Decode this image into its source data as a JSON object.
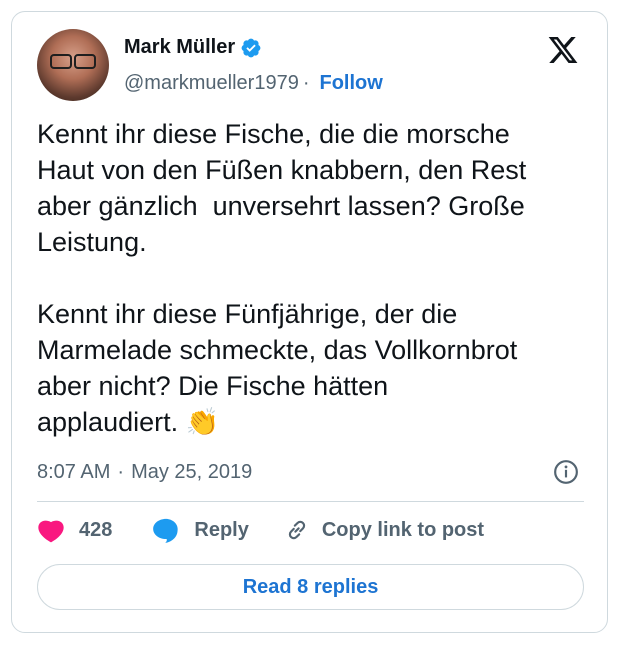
{
  "author": {
    "name": "Mark Müller",
    "handle": "@markmueller1979",
    "follow_label": "Follow",
    "separator": "·"
  },
  "tweet": {
    "text": "Kennt ihr diese Fische, die die morsche\nHaut von den Füßen knabbern, den Rest\naber gänzlich  unversehrt lassen? Große\nLeistung.\n\nKennt ihr diese Fünfjährige, der die\nMarmelade schmeckte, das Vollkornbrot\naber nicht? Die Fische hätten\napplaudiert. 👏",
    "time": "8:07 AM",
    "date": "May 25, 2019"
  },
  "actions": {
    "likes": "428",
    "reply_label": "Reply",
    "copy_link_label": "Copy link to post"
  },
  "read_replies_label": "Read 8 replies",
  "colors": {
    "accent": "#1d74d2",
    "heart": "#f91880",
    "reply_bubble": "#1d9bf0",
    "text": "#0f1419",
    "muted": "#536471"
  },
  "icons": [
    "verified-badge-icon",
    "x-logo-icon",
    "info-icon",
    "heart-icon",
    "reply-bubble-icon",
    "link-icon"
  ]
}
